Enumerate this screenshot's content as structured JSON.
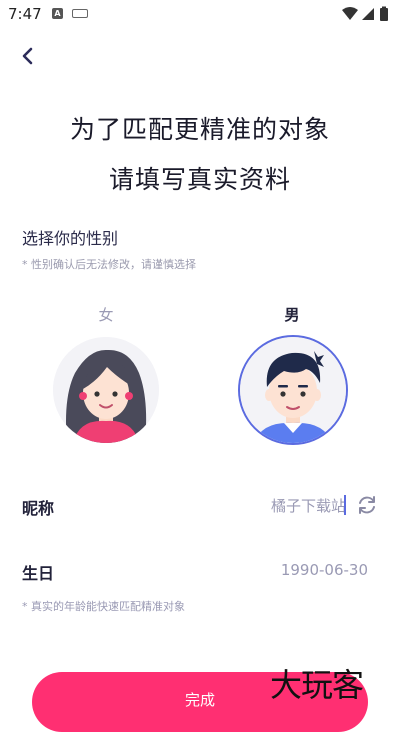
{
  "status_bar": {
    "time": "7:47",
    "icon_a": "A"
  },
  "header": {
    "back_icon": "chevron-left-icon"
  },
  "headline": {
    "line1": "为了匹配更精准的对象",
    "line2": "请填写真实资料"
  },
  "gender": {
    "title": "选择你的性别",
    "note": "* 性别确认后无法修改，请谨慎选择",
    "female_label": "女",
    "male_label": "男",
    "selected": "男"
  },
  "nickname": {
    "label": "昵称",
    "value": "橘子下载站"
  },
  "birthday": {
    "label": "生日",
    "value": "1990-06-30",
    "note": "* 真实的年龄能快速匹配精准对象"
  },
  "submit": {
    "label": "完成"
  },
  "watermark": {
    "text": "大玩客"
  },
  "colors": {
    "accent": "#ff2f72",
    "selection": "#5b6be0",
    "muted": "#9a9ab4"
  }
}
